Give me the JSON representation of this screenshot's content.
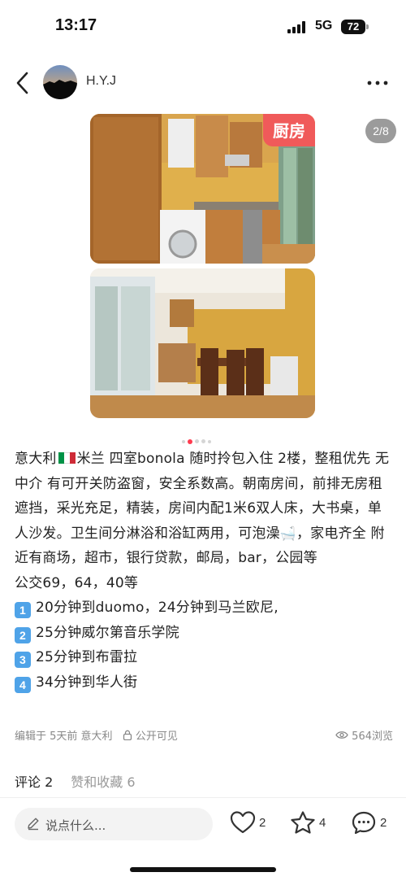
{
  "status_bar": {
    "time": "13:17",
    "network": "5G",
    "battery": "72"
  },
  "header": {
    "username": "H.Y.J",
    "back_icon": "chevron-left-icon",
    "more_icon": "more-dots-icon"
  },
  "gallery": {
    "tag": "厨房",
    "page_indicator": "2/8",
    "active_index": 2,
    "total_dots": 5
  },
  "post": {
    "line_intro_before_flag": "意大利",
    "line_intro_after_flag": "米兰 四室bonola 随时拎包入住 2楼，整租优先 无中介 有可开关防盗窗，安全系数高。朝南房间，前排无房租遮挡，采光充足，精装，房间内配1米6双人床，大书桌，单人沙发。卫生间分淋浴和浴缸两用，可泡澡",
    "line_intro_end": "，家电齐全 附近有商场，超市，银行贷款，邮局，bar，公园等",
    "bus": "公交69，64，40等",
    "routes": [
      {
        "num": "1",
        "text": "20分钟到duomo，24分钟到马兰欧尼,"
      },
      {
        "num": "2",
        "text": "25分钟威尔第音乐学院"
      },
      {
        "num": "3",
        "text": "25分钟到布雷拉"
      },
      {
        "num": "4",
        "text": "34分钟到华人街"
      }
    ]
  },
  "meta": {
    "edited": "编辑于 5天前 意大利",
    "visibility": "公开可见",
    "views": "564浏览"
  },
  "tabs": {
    "comments": "评论 2",
    "likes_favs": "赞和收藏 6"
  },
  "bottom_bar": {
    "input_placeholder": "说点什么...",
    "like_count": "2",
    "star_count": "4",
    "comment_count": "2"
  },
  "colors": {
    "accent_red": "#f05a5a",
    "flag_green": "#009246",
    "flag_white": "#ffffff",
    "flag_red": "#ce2b37",
    "keycap_blue": "#4fa3e8"
  }
}
